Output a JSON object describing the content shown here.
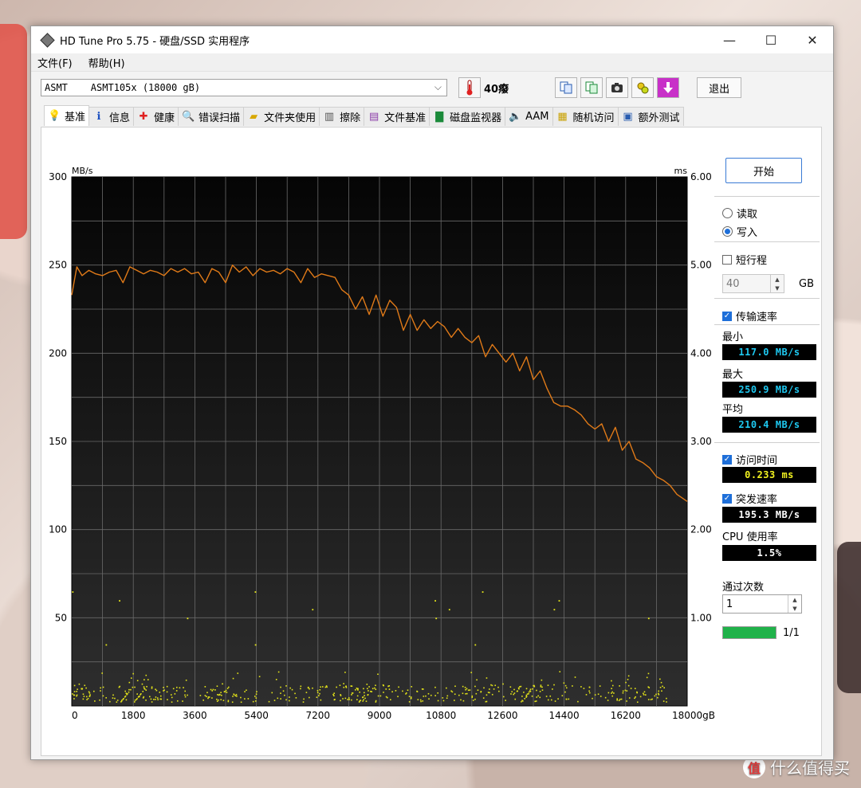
{
  "window": {
    "title": "HD Tune Pro 5.75 - 硬盘/SSD 实用程序"
  },
  "menu": [
    "文件(F)",
    "帮助(H)"
  ],
  "toolbar": {
    "drive": "ASMT    ASMT105x (18000 gB)",
    "temperature": "40癈",
    "exit_label": "退出"
  },
  "tabs": [
    {
      "label": "基准",
      "icon": "bulb-icon",
      "active": true
    },
    {
      "label": "信息",
      "icon": "info-icon"
    },
    {
      "label": "健康",
      "icon": "health-cross-icon"
    },
    {
      "label": "错误扫描",
      "icon": "magnifier-icon"
    },
    {
      "label": "文件夹使用",
      "icon": "folder-icon"
    },
    {
      "label": "擦除",
      "icon": "trash-icon"
    },
    {
      "label": "文件基准",
      "icon": "file-benchmark-icon"
    },
    {
      "label": "磁盘监视器",
      "icon": "monitor-icon"
    },
    {
      "label": "AAM",
      "icon": "speaker-icon"
    },
    {
      "label": "随机访问",
      "icon": "random-access-icon"
    },
    {
      "label": "额外测试",
      "icon": "extra-test-icon"
    }
  ],
  "panel": {
    "start_label": "开始",
    "read_label": "读取",
    "write_label": "写入",
    "mode_selected": "write",
    "short_stroke_label": "短行程",
    "short_stroke_checked": false,
    "short_stroke_value": "40",
    "short_stroke_unit": "GB",
    "transfer_rate_label": "传输速率",
    "transfer_rate_checked": true,
    "min_label": "最小",
    "min_value": "117.0 MB/s",
    "max_label": "最大",
    "max_value": "250.9 MB/s",
    "avg_label": "平均",
    "avg_value": "210.4 MB/s",
    "access_time_label": "访问时间",
    "access_time_checked": true,
    "access_time_value": "0.233 ms",
    "burst_label": "突发速率",
    "burst_checked": true,
    "burst_value": "195.3 MB/s",
    "cpu_label": "CPU 使用率",
    "cpu_value": "1.5%",
    "passes_label": "通过次数",
    "passes_value": "1",
    "progress_text": "1/1",
    "progress_fraction": 1.0
  },
  "colors": {
    "rate_line": "#e07a18",
    "access_points": "#e6e619",
    "lcd_cyan": "#1ec8f0",
    "lcd_yellow": "#f0f020",
    "lcd_white": "#ffffff"
  },
  "chart_data": {
    "type": "line",
    "y_left_unit": "MB/s",
    "y_right_unit": "ms",
    "x_unit": "gB",
    "xlim": [
      0,
      18000
    ],
    "ylim_left": [
      0,
      300
    ],
    "ylim_right": [
      0,
      6
    ],
    "x_ticks": [
      0,
      1800,
      3600,
      5400,
      7200,
      9000,
      10800,
      12600,
      14400,
      16200,
      18000
    ],
    "x_tick_labels": [
      "0",
      "1800",
      "3600",
      "5400",
      "7200",
      "9000",
      "10800",
      "12600",
      "14400",
      "16200",
      "18000gB"
    ],
    "y_left_ticks": [
      50,
      100,
      150,
      200,
      250,
      300
    ],
    "y_right_ticks": [
      "1.00",
      "2.00",
      "3.00",
      "4.00",
      "5.00",
      "6.00"
    ],
    "grid": true,
    "series": [
      {
        "x": [
          0,
          150,
          300,
          500,
          700,
          900,
          1100,
          1300,
          1500,
          1700,
          1900,
          2100,
          2300,
          2500,
          2700,
          2900,
          3100,
          3300,
          3500,
          3700,
          3900,
          4100,
          4300,
          4500,
          4700,
          4900,
          5100,
          5300,
          5500,
          5700,
          5900,
          6100,
          6300,
          6500,
          6700,
          6900,
          7100,
          7300,
          7500,
          7700,
          7900,
          8100,
          8300,
          8500,
          8700,
          8900,
          9100,
          9300,
          9500,
          9700,
          9900,
          10100,
          10300,
          10500,
          10700,
          10900,
          11100,
          11300,
          11500,
          11700,
          11900,
          12100,
          12300,
          12500,
          12700,
          12900,
          13100,
          13300,
          13500,
          13700,
          13900,
          14100,
          14300,
          14500,
          14700,
          14900,
          15100,
          15300,
          15500,
          15700,
          15900,
          16100,
          16300,
          16500,
          16700,
          16900,
          17100,
          17300,
          17500,
          17700,
          18000
        ],
        "values": [
          233,
          249,
          244,
          247,
          245,
          244,
          246,
          247,
          240,
          249,
          247,
          245,
          247,
          246,
          244,
          248,
          246,
          248,
          245,
          246,
          240,
          248,
          246,
          240,
          250,
          246,
          249,
          244,
          248,
          246,
          247,
          245,
          248,
          246,
          240,
          248,
          243,
          245,
          244,
          243,
          236,
          233,
          225,
          232,
          222,
          233,
          221,
          230,
          226,
          213,
          222,
          213,
          219,
          214,
          218,
          215,
          209,
          214,
          209,
          206,
          210,
          198,
          205,
          200,
          195,
          200,
          190,
          198,
          185,
          190,
          180,
          172,
          170,
          170,
          168,
          165,
          160,
          157,
          160,
          150,
          158,
          145,
          150,
          140,
          138,
          135,
          130,
          128,
          125,
          120,
          116
        ]
      }
    ],
    "access_time_ms": {
      "typical": [
        0.05,
        0.4
      ],
      "outliers": [
        0.7,
        1.0,
        1.1,
        1.2,
        1.3
      ]
    }
  }
}
